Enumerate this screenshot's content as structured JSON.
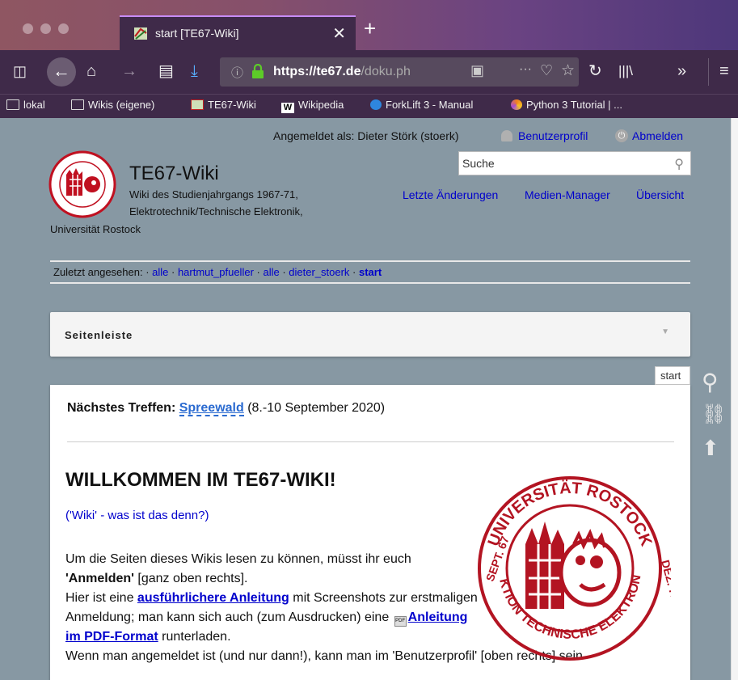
{
  "browser": {
    "tab_title": "start [TE67-Wiki]",
    "url_domain": "https://te67.de",
    "url_path": "/doku.ph",
    "bookmarks": [
      "lokal",
      "Wikis (eigene)",
      "TE67-Wiki",
      "Wikipedia",
      "ForkLift 3 - Manual",
      "Python 3 Tutorial | ..."
    ]
  },
  "header": {
    "logged_in": "Angemeldet als: Dieter Störk (stoerk)",
    "profile_link": "Benutzerprofil",
    "logout_link": "Abmelden",
    "site_title": "TE67-Wiki",
    "tagline_1": "Wiki des Studienjahrgangs 1967-71,",
    "tagline_2": "Elektrotechnik/Technische Elektronik,",
    "tagline_3": "Universität Rostock",
    "search_placeholder": "Suche",
    "tools": [
      "Letzte Änderungen",
      "Medien-Manager",
      "Übersicht"
    ]
  },
  "breadcrumbs": {
    "label": "Zuletzt angesehen:",
    "items": [
      "alle",
      "hartmut_pfueller",
      "alle",
      "dieter_stoerk",
      "start"
    ]
  },
  "sidebar": {
    "title": "Seitenleiste"
  },
  "page_id": "start",
  "content": {
    "next_meeting_label": "Nächstes Treffen:",
    "next_meeting_link": "Spreewald",
    "next_meeting_date": "(8.-10 September 2020)",
    "heading": "WILLKOMMEN IM TE67-WIKI!",
    "wiki_link": "('Wiki' - was ist das denn?)",
    "p1a": "Um die Seiten dieses Wikis lesen zu können, müsst ihr euch ",
    "p1b": "'Anmelden'",
    "p1c": " [ganz oben rechts].",
    "p2a": "Hier ist eine ",
    "p2b": "ausführlichere Anleitung",
    "p2c": " mit Screenshots zur erstmaligen Anmeldung; man kann sich auch (zum Ausdrucken) eine ",
    "p2d": "Anleitung im PDF-Format",
    "p2e": " runterladen.",
    "p3": "Wenn man angemeldet ist (und nur dann!), kann man im 'Benutzerprofil' [oben rechts] sein",
    "stamp_top": "UNIVERSITÄT ROSTOCK",
    "stamp_left": "SEPT. 67",
    "stamp_right": "DEZ. 71",
    "stamp_bottom": "SEKTION TECHNISCHE ELEKTRONIK"
  }
}
